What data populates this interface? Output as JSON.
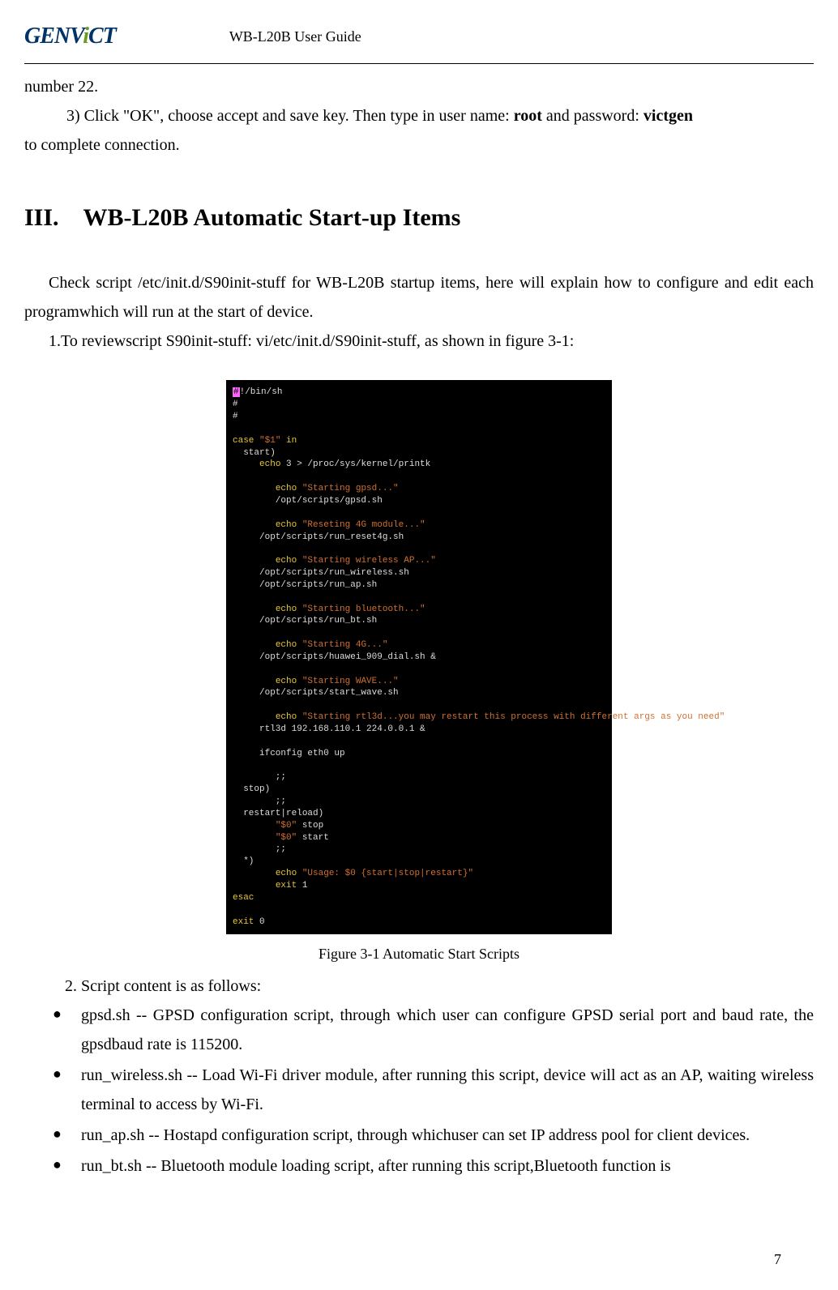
{
  "header": {
    "logo": "GENViCT",
    "doc_title": "WB-L20B User Guide"
  },
  "body": {
    "line1": "number 22.",
    "line2a": "3) Click \"OK\", choose accept and save key. Then type in user name: ",
    "line2b": "root",
    "line2c": " and password: ",
    "line2d": "victgen",
    "line3": "to complete connection."
  },
  "section": {
    "roman": "III.",
    "title": "WB-L20B Automatic Start-up Items",
    "p1": "Check script /etc/init.d/S90init-stuff for WB-L20B startup items, here will explain how to configure and edit each programwhich will run at the start of device.",
    "p2": "1.To reviewscript S90init-stuff: vi/etc/init.d/S90init-stuff, as shown in figure 3-1:",
    "caption": "Figure 3-1 Automatic Start Scripts",
    "p3": "2. Script content is as follows:",
    "bullets": [
      "gpsd.sh -- GPSD configuration script, through which user can configure GPSD serial port and baud rate, the gpsdbaud rate is 115200.",
      "run_wireless.sh -- Load Wi-Fi driver module, after running this script, device will act as an AP, waiting wireless terminal to access by Wi-Fi.",
      "run_ap.sh -- Hostapd configuration script, through whichuser can set IP address pool for client devices.",
      "run_bt.sh -- Bluetooth module loading script, after running this script,Bluetooth function is"
    ]
  },
  "terminal": {
    "lines": [
      "#!/bin/sh",
      "#",
      "#",
      "",
      "case \"$1\" in",
      "  start)",
      "     echo 3 > /proc/sys/kernel/printk",
      "",
      "        echo \"Starting gpsd...\"",
      "        /opt/scripts/gpsd.sh",
      "",
      "        echo \"Reseting 4G module...\"",
      "     /opt/scripts/run_reset4g.sh",
      "",
      "        echo \"Starting wireless AP...\"",
      "     /opt/scripts/run_wireless.sh",
      "     /opt/scripts/run_ap.sh",
      "",
      "        echo \"Starting bluetooth...\"",
      "     /opt/scripts/run_bt.sh",
      "",
      "        echo \"Starting 4G...\"",
      "     /opt/scripts/huawei_909_dial.sh &",
      "",
      "        echo \"Starting WAVE...\"",
      "     /opt/scripts/start_wave.sh",
      "",
      "        echo \"Starting rtl3d...you may restart this process with different args as you need\"",
      "     rtl3d 192.168.110.1 224.0.0.1 &",
      "",
      "     ifconfig eth0 up",
      "",
      "        ;;",
      "  stop)",
      "        ;;",
      "  restart|reload)",
      "        \"$0\" stop",
      "        \"$0\" start",
      "        ;;",
      "  *)",
      "        echo \"Usage: $0 {start|stop|restart}\"",
      "        exit 1",
      "esac",
      "",
      "exit 0"
    ]
  },
  "page_number": "7"
}
